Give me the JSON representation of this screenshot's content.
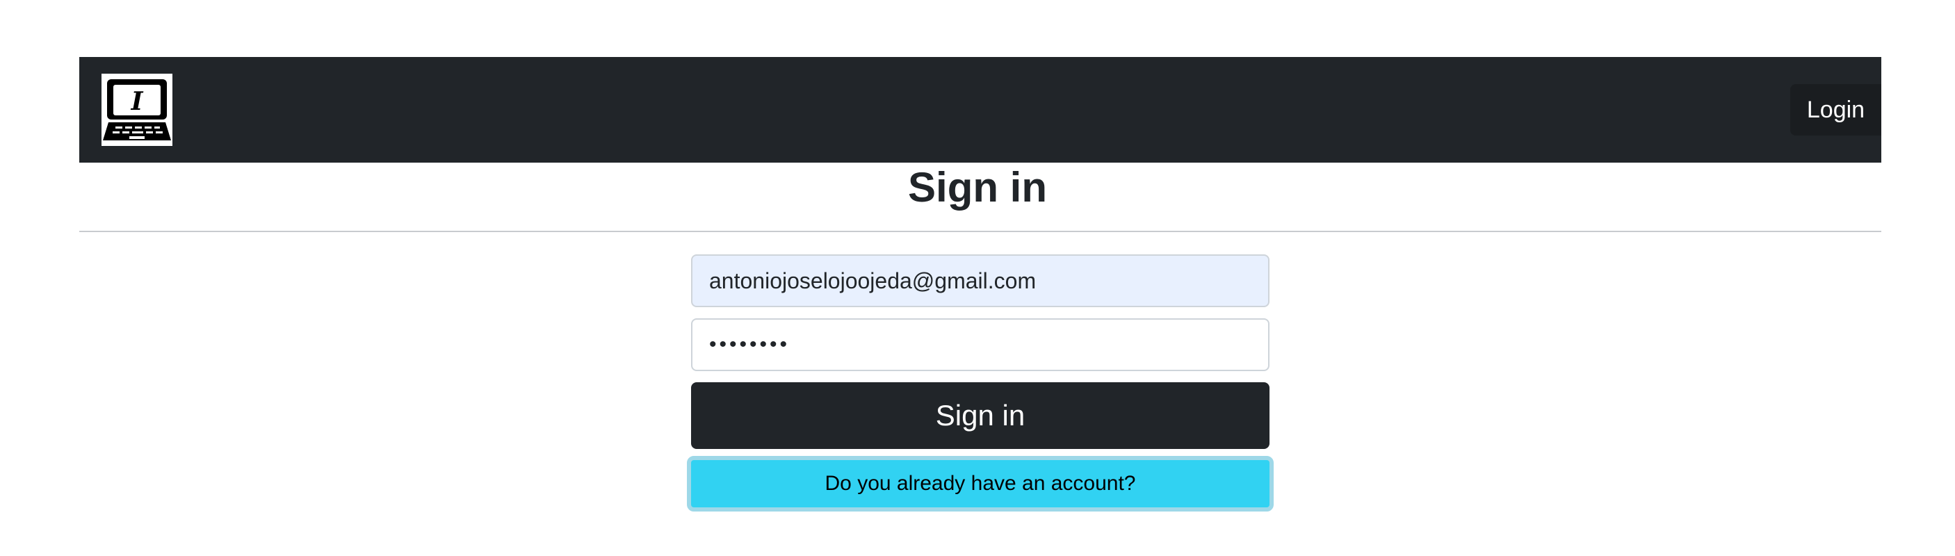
{
  "navbar": {
    "logo_icon": "laptop-icon",
    "logo_letter": "I",
    "login_label": "Login"
  },
  "main": {
    "title": "Sign in"
  },
  "form": {
    "email_value": "antoniojoselojoojeda@gmail.com",
    "password_value": "••••••••",
    "submit_label": "Sign in",
    "account_label": "Do you already have an account?"
  },
  "colors": {
    "navbar_bg": "#212529",
    "primary_dark": "#212529",
    "info": "#31d2f2",
    "autofill_bg": "#e8f0fe"
  }
}
